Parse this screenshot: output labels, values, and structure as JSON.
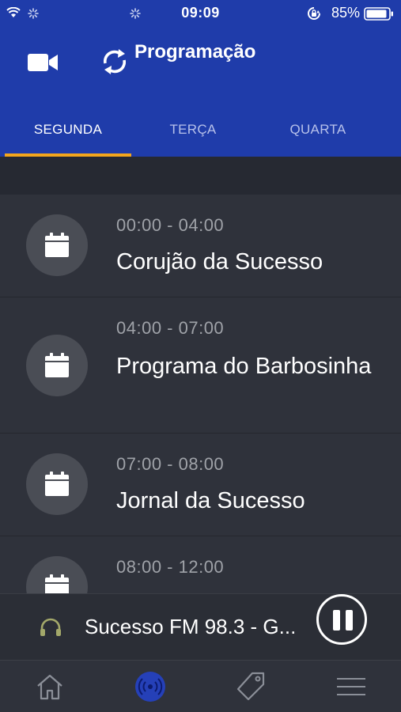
{
  "status_bar": {
    "time": "09:09",
    "battery_percent": "85%"
  },
  "header": {
    "title": "Programação",
    "left_icon": "video-camera-icon",
    "title_icon": "sync-icon",
    "background_color": "#1f3caa"
  },
  "tabs": [
    {
      "label": "SEGUNDA",
      "active": true
    },
    {
      "label": "TERÇA",
      "active": false
    },
    {
      "label": "QUARTA",
      "active": false
    }
  ],
  "accent_color": "#f3a61d",
  "schedule": [
    {
      "time": "00:00 - 04:00",
      "title": "Corujão da Sucesso",
      "icon": "calendar-icon"
    },
    {
      "time": "04:00 - 07:00",
      "title": "Programa do Barbosinha",
      "icon": "calendar-icon"
    },
    {
      "time": "07:00 - 08:00",
      "title": "Jornal da Sucesso",
      "icon": "calendar-icon"
    },
    {
      "time": "08:00 - 12:00",
      "title": "",
      "icon": "calendar-icon"
    }
  ],
  "player": {
    "station": "Sucesso FM 98.3 - G...",
    "icon": "headphones-icon",
    "control": "pause-icon"
  },
  "tab_bar": [
    {
      "icon": "home-icon",
      "active": false
    },
    {
      "icon": "radio-broadcast-icon",
      "active": true
    },
    {
      "icon": "tag-icon",
      "active": false
    },
    {
      "icon": "menu-icon",
      "active": false
    }
  ]
}
